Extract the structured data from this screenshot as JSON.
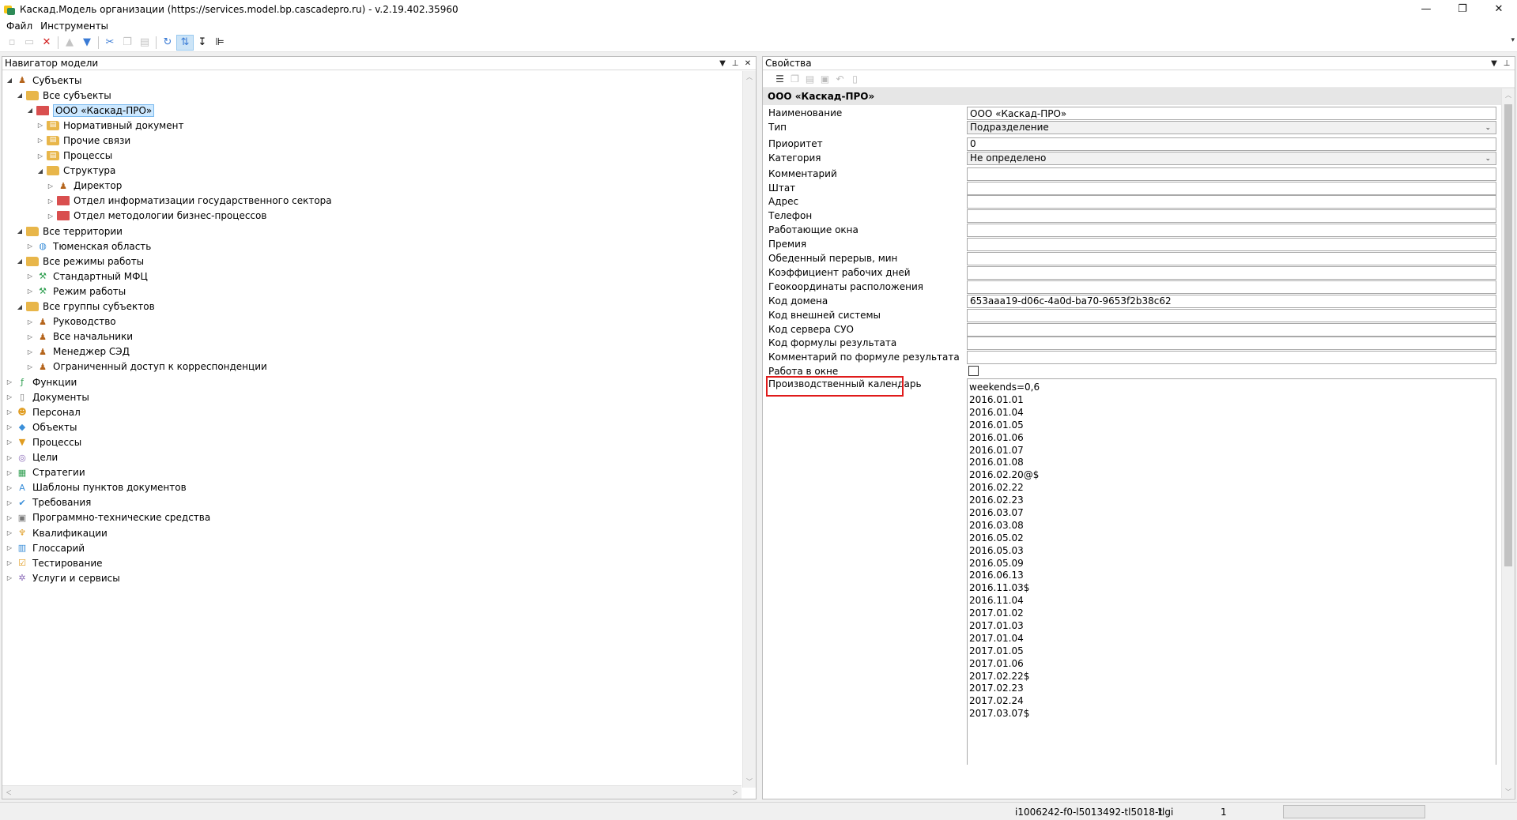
{
  "window": {
    "title": "Каскад.Модель организации (https://services.model.bp.cascadepro.ru) - v.2.19.402.35960",
    "minimize": "—",
    "restore": "❐",
    "close": "✕"
  },
  "menu": [
    "Файл",
    "Инструменты"
  ],
  "navigator": {
    "title": "Навигатор модели",
    "tree": [
      {
        "label": "Субъекты",
        "level": 0,
        "icon": "subjects-icon",
        "exp": "◢"
      },
      {
        "label": "Все субъекты",
        "level": 1,
        "icon": "folder-icon",
        "exp": "◢"
      },
      {
        "label": "ООО «Каскад-ПРО»",
        "level": 2,
        "icon": "organization-icon",
        "exp": "◢",
        "selected": true
      },
      {
        "label": "Нормативный документ",
        "level": 3,
        "icon": "folder-document-icon",
        "exp": "▷"
      },
      {
        "label": "Прочие связи",
        "level": 3,
        "icon": "folder-document-icon",
        "exp": "▷"
      },
      {
        "label": "Процессы",
        "level": 3,
        "icon": "folder-document-icon",
        "exp": "▷"
      },
      {
        "label": "Структура",
        "level": 3,
        "icon": "folder-icon",
        "exp": "◢"
      },
      {
        "label": "Директор",
        "level": 4,
        "icon": "person-icon",
        "exp": "▷"
      },
      {
        "label": "Отдел информатизации государственного сектора",
        "level": 4,
        "icon": "organization-icon",
        "exp": "▷"
      },
      {
        "label": "Отдел методологии бизнес-процессов",
        "level": 4,
        "icon": "organization-icon",
        "exp": "▷"
      },
      {
        "label": "Все территории",
        "level": 1,
        "icon": "folder-icon",
        "exp": "◢"
      },
      {
        "label": "Тюменская область",
        "level": 2,
        "icon": "globe-icon",
        "exp": "▷"
      },
      {
        "label": "Все режимы работы",
        "level": 1,
        "icon": "folder-icon",
        "exp": "◢"
      },
      {
        "label": "Стандартный МФЦ",
        "level": 2,
        "icon": "work-mode-icon",
        "exp": "▷"
      },
      {
        "label": "Режим работы",
        "level": 2,
        "icon": "work-mode-icon",
        "exp": "▷"
      },
      {
        "label": "Все группы субъектов",
        "level": 1,
        "icon": "folder-icon",
        "exp": "◢"
      },
      {
        "label": "Руководство",
        "level": 2,
        "icon": "group-icon",
        "exp": "▷"
      },
      {
        "label": "Все начальники",
        "level": 2,
        "icon": "group-icon",
        "exp": "▷"
      },
      {
        "label": "Менеджер СЭД",
        "level": 2,
        "icon": "group-icon",
        "exp": "▷"
      },
      {
        "label": "Ограниченный доступ к корреспонденции",
        "level": 2,
        "icon": "group-icon",
        "exp": "▷"
      },
      {
        "label": "Функции",
        "level": 0,
        "icon": "function-icon",
        "exp": "▷"
      },
      {
        "label": "Документы",
        "level": 0,
        "icon": "document-icon",
        "exp": "▷"
      },
      {
        "label": "Персонал",
        "level": 0,
        "icon": "personnel-icon",
        "exp": "▷"
      },
      {
        "label": "Объекты",
        "level": 0,
        "icon": "objects-icon",
        "exp": "▷"
      },
      {
        "label": "Процессы",
        "level": 0,
        "icon": "process-icon",
        "exp": "▷"
      },
      {
        "label": "Цели",
        "level": 0,
        "icon": "target-icon",
        "exp": "▷"
      },
      {
        "label": "Стратегии",
        "level": 0,
        "icon": "strategy-icon",
        "exp": "▷"
      },
      {
        "label": "Шаблоны пунктов документов",
        "level": 0,
        "icon": "template-icon",
        "exp": "▷"
      },
      {
        "label": "Требования",
        "level": 0,
        "icon": "requirement-icon",
        "exp": "▷"
      },
      {
        "label": "Программно-технические средства",
        "level": 0,
        "icon": "software-icon",
        "exp": "▷"
      },
      {
        "label": "Квалификации",
        "level": 0,
        "icon": "qualification-icon",
        "exp": "▷"
      },
      {
        "label": "Глоссарий",
        "level": 0,
        "icon": "glossary-icon",
        "exp": "▷"
      },
      {
        "label": "Тестирование",
        "level": 0,
        "icon": "testing-icon",
        "exp": "▷"
      },
      {
        "label": "Услуги и сервисы",
        "level": 0,
        "icon": "services-icon",
        "exp": "▷"
      }
    ]
  },
  "properties": {
    "title": "Свойства",
    "group": "ООО «Каскад-ПРО»",
    "fields": [
      {
        "name": "Наименование",
        "value": "ООО «Каскад-ПРО»",
        "type": "text"
      },
      {
        "name": "Тип",
        "value": "Подразделение",
        "type": "combo"
      },
      {
        "name": "Приоритет",
        "value": "0",
        "type": "text"
      },
      {
        "name": "Категория",
        "value": "Не определено",
        "type": "combo"
      },
      {
        "name": "Комментарий",
        "value": "",
        "type": "text"
      },
      {
        "name": "Штат",
        "value": "",
        "type": "text"
      },
      {
        "name": "Адрес",
        "value": "",
        "type": "text"
      },
      {
        "name": "Телефон",
        "value": "",
        "type": "text"
      },
      {
        "name": "Работающие окна",
        "value": "",
        "type": "text"
      },
      {
        "name": "Премия",
        "value": "",
        "type": "text"
      },
      {
        "name": "Обеденный перерыв, мин",
        "value": "",
        "type": "text"
      },
      {
        "name": "Коэффициент рабочих дней",
        "value": "",
        "type": "text"
      },
      {
        "name": "Геокоординаты расположения",
        "value": "",
        "type": "text"
      },
      {
        "name": "Код домена",
        "value": "653aaa19-d06c-4a0d-ba70-9653f2b38c62",
        "type": "text"
      },
      {
        "name": "Код внешней системы",
        "value": "",
        "type": "text"
      },
      {
        "name": "Код сервера СУО",
        "value": "",
        "type": "text"
      },
      {
        "name": "Код формулы результата",
        "value": "",
        "type": "text"
      },
      {
        "name": "Комментарий по формуле результата",
        "value": "",
        "type": "text"
      },
      {
        "name": "Работа в окне",
        "value": "",
        "type": "checkbox"
      }
    ],
    "calendar": {
      "name": "Производственный календарь",
      "lines": [
        "weekends=0,6",
        "2016.01.01",
        "2016.01.04",
        "2016.01.05",
        "2016.01.06",
        "2016.01.07",
        "2016.01.08",
        "2016.02.20@$",
        "2016.02.22",
        "2016.02.23",
        "2016.03.07",
        "2016.03.08",
        "2016.05.02",
        "2016.05.03",
        "2016.05.09",
        "2016.06.13",
        "2016.11.03$",
        "2016.11.04",
        "2017.01.02",
        "2017.01.03",
        "2017.01.04",
        "2017.01.05",
        "2017.01.06",
        "2017.02.22$",
        "2017.02.23",
        "2017.02.24",
        "2017.03.07$"
      ]
    }
  },
  "status": {
    "session": "i1006242-f0-l5013492-tl5018-tlgi",
    "value1": "1",
    "value2": "1"
  },
  "colors": {
    "accent_red": "#e01b1b",
    "selection": "#cce8ff"
  }
}
